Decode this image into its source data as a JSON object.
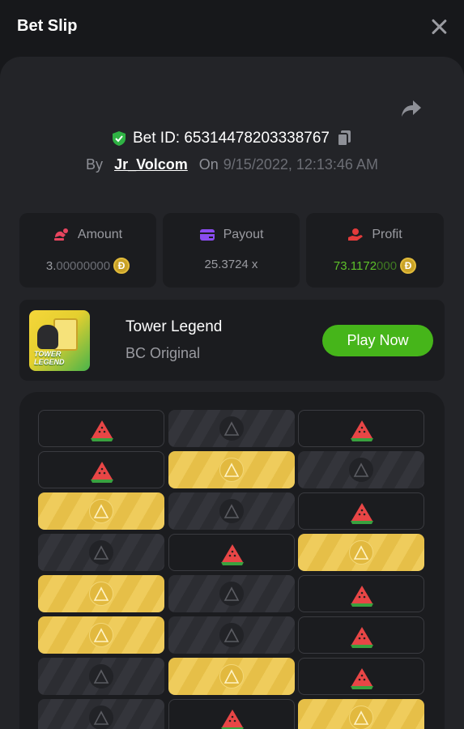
{
  "header": {
    "title": "Bet Slip"
  },
  "bet": {
    "id_text": "Bet ID: 65314478203338767",
    "by_label": "By",
    "user": "Jr_Volcom",
    "on_label": "On",
    "datetime": "9/15/2022, 12:13:46 AM"
  },
  "stats": {
    "amount": {
      "label": "Amount",
      "value_main": "3.",
      "value_tail": "00000000",
      "coin": "Ð"
    },
    "payout": {
      "label": "Payout",
      "value": "25.3724 x"
    },
    "profit": {
      "label": "Profit",
      "value_main": "73.1172",
      "value_tail": "000",
      "coin": "Ð"
    }
  },
  "game": {
    "name": "Tower Legend",
    "subtitle": "BC Original",
    "thumb_text_line1": "TOWER",
    "thumb_text_line2": "LEGEND",
    "play_label": "Play Now"
  },
  "board": {
    "rows": [
      [
        "melon",
        "dark",
        "melon"
      ],
      [
        "melon",
        "gold",
        "dark"
      ],
      [
        "gold",
        "dark",
        "melon"
      ],
      [
        "dark",
        "melon",
        "gold"
      ],
      [
        "gold",
        "dark",
        "melon"
      ],
      [
        "gold",
        "dark",
        "melon"
      ],
      [
        "dark",
        "gold",
        "melon"
      ],
      [
        "dark",
        "melon",
        "gold"
      ]
    ]
  },
  "colors": {
    "accent_green": "#46b51a",
    "profit_green": "#5dc02a",
    "panel": "#232428",
    "gold_tile": "#e6bf48"
  },
  "icons": [
    "close-icon",
    "share-icon",
    "shield-check-icon",
    "copy-icon",
    "amount-icon",
    "payout-card-icon",
    "profit-hand-icon",
    "coin-icon",
    "watermelon-icon",
    "slice-icon"
  ]
}
